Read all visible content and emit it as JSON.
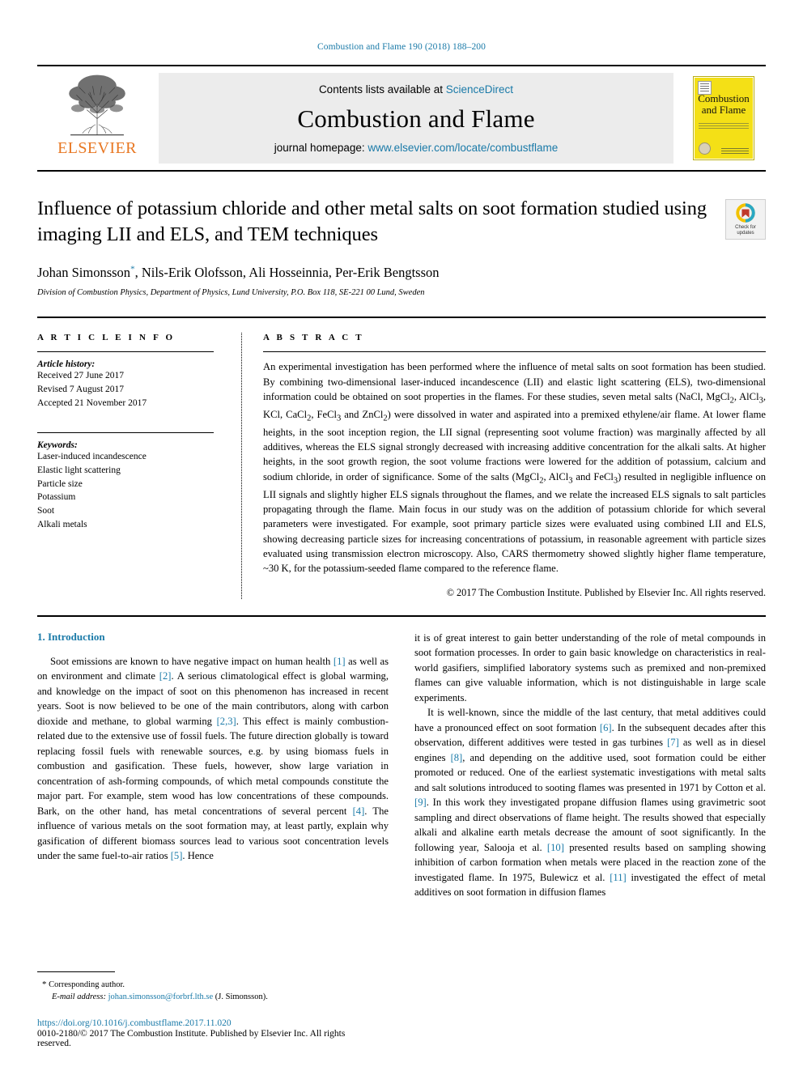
{
  "running_head": "Combustion and Flame 190 (2018) 188–200",
  "masthead": {
    "publisher_name": "ELSEVIER",
    "contents_prefix": "Contents lists available at ",
    "contents_link": "ScienceDirect",
    "journal_title": "Combustion and Flame",
    "homepage_prefix": "journal homepage: ",
    "homepage_url": "www.elsevier.com/locate/combustflame",
    "cover_title_line1": "Combustion",
    "cover_title_line2": "and Flame",
    "link_color": "#1a7aa8",
    "cover_color": "#f4e016",
    "elsevier_color": "#e87722"
  },
  "article": {
    "title": "Influence of potassium chloride and other metal salts on soot formation studied using imaging LII and ELS, and TEM techniques",
    "authors": "Johan Simonsson, Nils-Erik Olofsson, Ali Hosseinnia, Per-Erik Bengtsson",
    "author_marker": "*",
    "affiliation": "Division of Combustion Physics, Department of Physics, Lund University, P.O. Box 118, SE-221 00 Lund, Sweden",
    "crossmark_label_line1": "Check for",
    "crossmark_label_line2": "updates"
  },
  "article_info": {
    "heading": "A R T I C L E   I N F O",
    "history_label": "Article history:",
    "received": "Received 27 June 2017",
    "revised": "Revised 7 August 2017",
    "accepted": "Accepted 21 November 2017",
    "keywords_label": "Keywords:",
    "keywords": [
      "Laser-induced incandescence",
      "Elastic light scattering",
      "Particle size",
      "Potassium",
      "Soot",
      "Alkali metals"
    ]
  },
  "abstract": {
    "heading": "A B S T R A C T",
    "text": "An experimental investigation has been performed where the influence of metal salts on soot formation has been studied. By combining two-dimensional laser-induced incandescence (LII) and elastic light scattering (ELS), two-dimensional information could be obtained on soot properties in the flames. For these studies, seven metal salts (NaCl, MgCl2, AlCl3, KCl, CaCl2, FeCl3 and ZnCl2) were dissolved in water and aspirated into a premixed ethylene/air flame. At lower flame heights, in the soot inception region, the LII signal (representing soot volume fraction) was marginally affected by all additives, whereas the ELS signal strongly decreased with increasing additive concentration for the alkali salts. At higher heights, in the soot growth region, the soot volume fractions were lowered for the addition of potassium, calcium and sodium chloride, in order of significance. Some of the salts (MgCl2, AlCl3 and FeCl3) resulted in negligible influence on LII signals and slightly higher ELS signals throughout the flames, and we relate the increased ELS signals to salt particles propagating through the flame. Main focus in our study was on the addition of potassium chloride for which several parameters were investigated. For example, soot primary particle sizes were evaluated using combined LII and ELS, showing decreasing particle sizes for increasing concentrations of potassium, in reasonable agreement with particle sizes evaluated using transmission electron microscopy. Also, CARS thermometry showed slightly higher flame temperature, ~30 K, for the potassium-seeded flame compared to the reference flame.",
    "copyright": "© 2017 The Combustion Institute. Published by Elsevier Inc. All rights reserved."
  },
  "introduction": {
    "section_title": "1. Introduction",
    "left_para1_a": "Soot emissions are known to have negative impact on human health ",
    "left_ref1": "[1]",
    "left_para1_b": " as well as on environment and climate ",
    "left_ref2": "[2]",
    "left_para1_c": ". A serious climatological effect is global warming, and knowledge on the impact of soot on this phenomenon has increased in recent years. Soot is now believed to be one of the main contributors, along with carbon dioxide and methane, to global warming ",
    "left_ref3": "[2,3]",
    "left_para1_d": ". This effect is mainly combustion-related due to the extensive use of fossil fuels. The future direction globally is toward replacing fossil fuels with renewable sources, e.g. by using biomass fuels in combustion and gasification. These fuels, however, show large variation in concentration of ash-forming compounds, of which metal compounds constitute the major part. For example, stem wood has low concentrations of these compounds. Bark, on the other hand, has metal concentrations of several percent ",
    "left_ref4": "[4]",
    "left_para1_e": ". The influence of various metals on the soot formation may, at least partly, explain why gasification of different biomass sources lead to various soot concentration levels under the same fuel-to-air ratios ",
    "left_ref5": "[5]",
    "left_para1_f": ". Hence",
    "right_para1": "it is of great interest to gain better understanding of the role of metal compounds in soot formation processes. In order to gain basic knowledge on characteristics in real-world gasifiers, simplified laboratory systems such as premixed and non-premixed flames can give valuable information, which is not distinguishable in large scale experiments.",
    "right_para2_a": "It is well-known, since the middle of the last century, that metal additives could have a pronounced effect on soot formation ",
    "right_ref6": "[6]",
    "right_para2_b": ". In the subsequent decades after this observation, different additives were tested in gas turbines ",
    "right_ref7": "[7]",
    "right_para2_c": " as well as in diesel engines ",
    "right_ref8": "[8]",
    "right_para2_d": ", and depending on the additive used, soot formation could be either promoted or reduced. One of the earliest systematic investigations with metal salts and salt solutions introduced to sooting flames was presented in 1971 by Cotton et al. ",
    "right_ref9": "[9]",
    "right_para2_e": ". In this work they investigated propane diffusion flames using gravimetric soot sampling and direct observations of flame height. The results showed that especially alkali and alkaline earth metals decrease the amount of soot significantly. In the following year, Salooja et al. ",
    "right_ref10": "[10]",
    "right_para2_f": " presented results based on sampling showing inhibition of carbon formation when metals were placed in the reaction zone of the investigated flame. In 1975, Bulewicz et al. ",
    "right_ref11": "[11]",
    "right_para2_g": " investigated the effect of metal additives on soot formation in diffusion flames"
  },
  "footer": {
    "corresponding_marker": "*",
    "corresponding_label": "Corresponding author.",
    "email_label": "E-mail address:",
    "email": "johan.simonsson@forbrf.lth.se",
    "email_suffix": "(J. Simonsson).",
    "doi": "https://doi.org/10.1016/j.combustflame.2017.11.020",
    "issn_line": "0010-2180/© 2017 The Combustion Institute. Published by Elsevier Inc. All rights reserved."
  }
}
